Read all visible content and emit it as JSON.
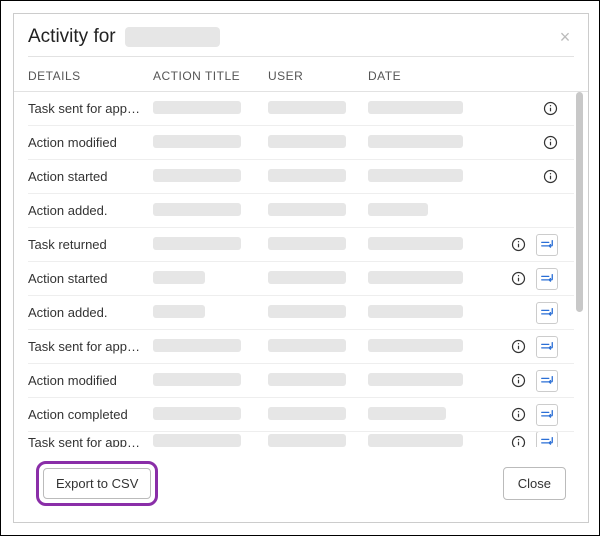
{
  "dialog": {
    "title_prefix": "Activity for",
    "close_label": "×",
    "columns": {
      "details": "DETAILS",
      "action_title": "ACTION TITLE",
      "user": "USER",
      "date": "DATE"
    },
    "rows": [
      {
        "details": "Task sent for app…",
        "info": true,
        "return": false,
        "aw": 88,
        "uw": 78,
        "dw": 95
      },
      {
        "details": "Action modified",
        "info": true,
        "return": false,
        "aw": 88,
        "uw": 78,
        "dw": 95
      },
      {
        "details": "Action started",
        "info": true,
        "return": false,
        "aw": 88,
        "uw": 78,
        "dw": 95
      },
      {
        "details": "Action added.",
        "info": false,
        "return": false,
        "aw": 88,
        "uw": 78,
        "dw": 60
      },
      {
        "details": "Task returned",
        "info": true,
        "return": true,
        "aw": 88,
        "uw": 78,
        "dw": 95
      },
      {
        "details": "Action started",
        "info": true,
        "return": true,
        "aw": 52,
        "uw": 78,
        "dw": 95
      },
      {
        "details": "Action added.",
        "info": false,
        "return": true,
        "aw": 52,
        "uw": 78,
        "dw": 95
      },
      {
        "details": "Task sent for app…",
        "info": true,
        "return": true,
        "aw": 88,
        "uw": 78,
        "dw": 95
      },
      {
        "details": "Action modified",
        "info": true,
        "return": true,
        "aw": 88,
        "uw": 78,
        "dw": 95
      },
      {
        "details": "Action completed",
        "info": true,
        "return": true,
        "aw": 88,
        "uw": 78,
        "dw": 78
      },
      {
        "details": "Task sent for app…",
        "info": true,
        "return": true,
        "aw": 88,
        "uw": 78,
        "dw": 95
      }
    ],
    "footer": {
      "export_label": "Export to CSV",
      "close_label": "Close"
    }
  }
}
